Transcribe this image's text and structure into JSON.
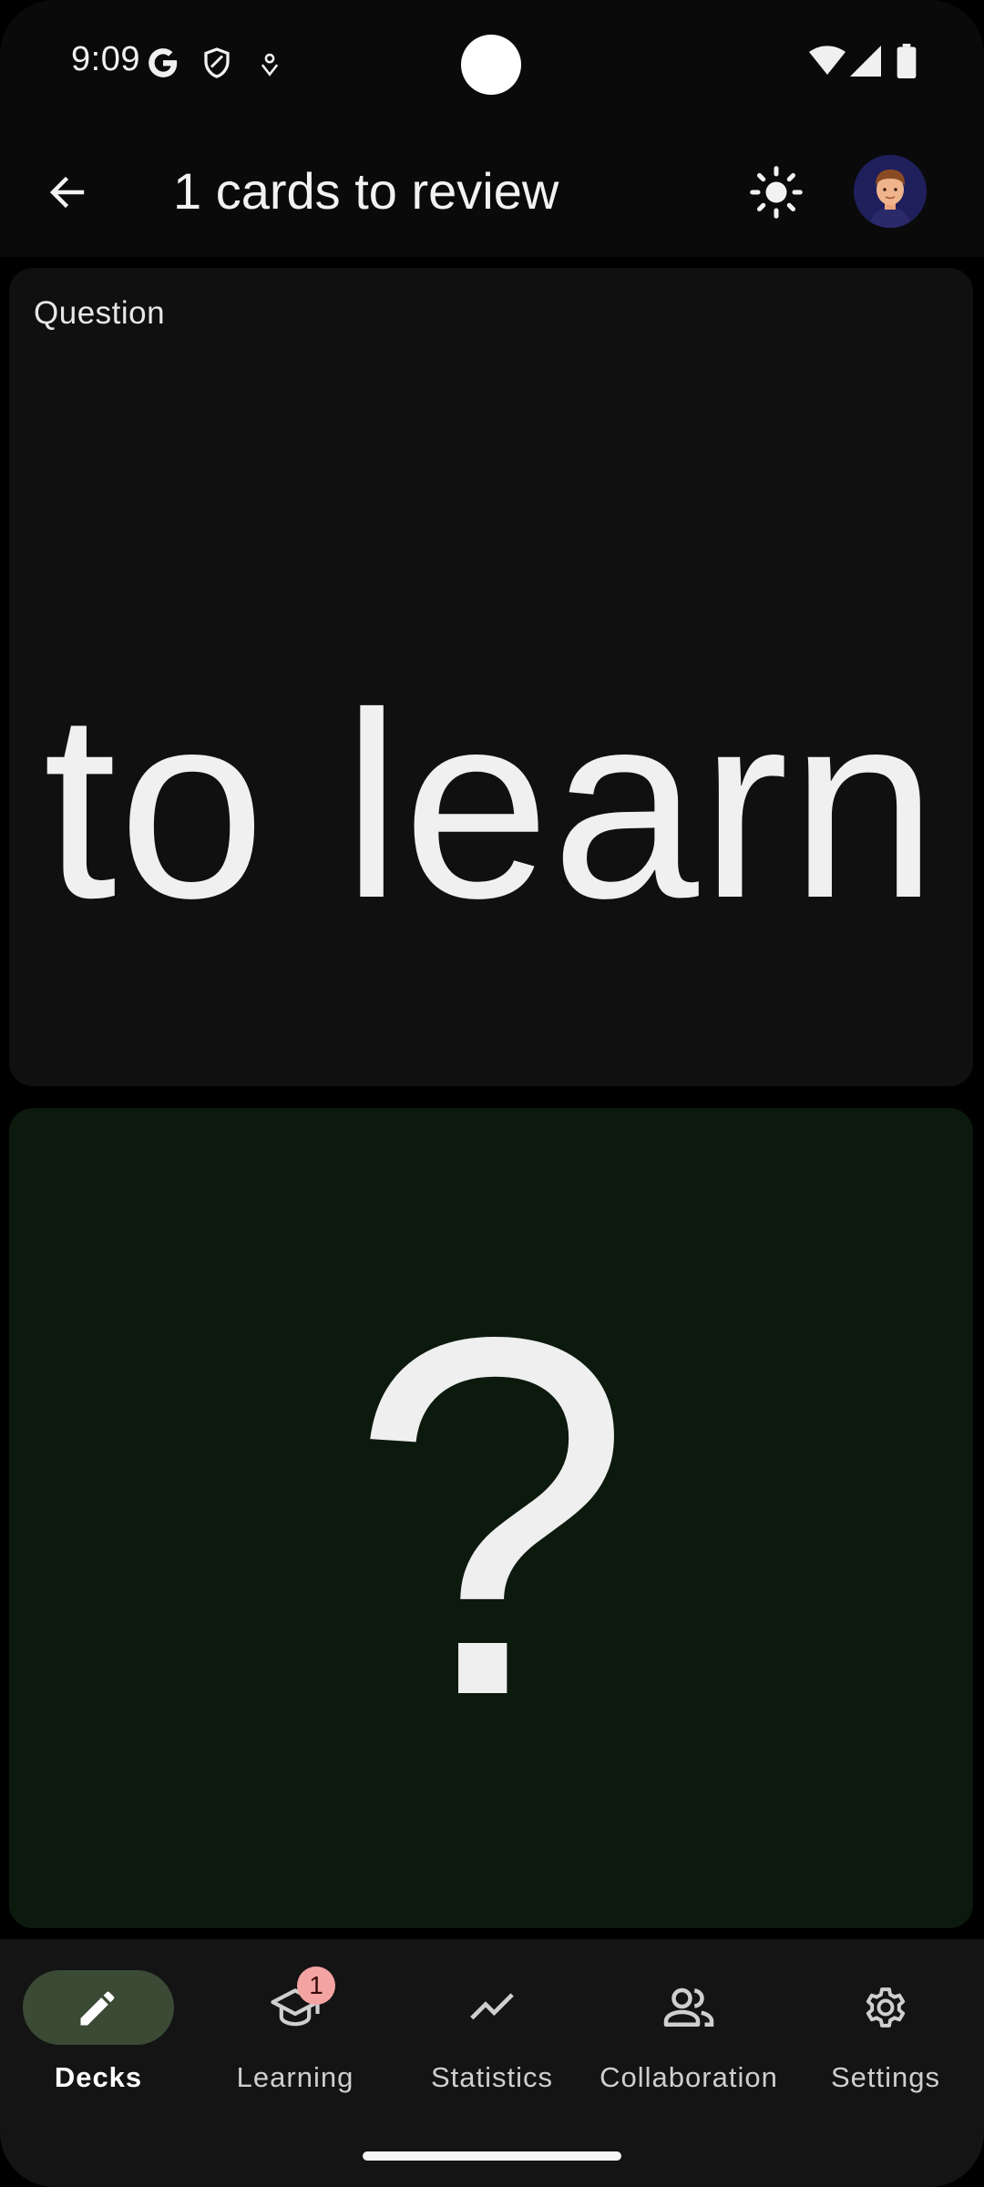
{
  "status_bar": {
    "time": "9:09",
    "left_icons": [
      "google-g-icon",
      "shield-icon",
      "location-pin-icon"
    ],
    "right_icons": [
      "wifi-icon",
      "cellular-signal-icon",
      "battery-icon"
    ]
  },
  "app_bar": {
    "title": "1 cards to review",
    "back_icon": "arrow-left-icon",
    "theme_icon": "sun-icon",
    "avatar_icon": "user-avatar"
  },
  "question_card": {
    "label": "Question",
    "text": "to learn"
  },
  "answer_card": {
    "mark": "?",
    "background": "#0c1a0d"
  },
  "bottom_nav": {
    "items": [
      {
        "label": "Decks",
        "icon": "pencil-icon",
        "active": true
      },
      {
        "label": "Learning",
        "icon": "graduation-cap-icon",
        "badge": "1"
      },
      {
        "label": "Statistics",
        "icon": "trend-line-icon"
      },
      {
        "label": "Collaboration",
        "icon": "people-icon"
      },
      {
        "label": "Settings",
        "icon": "gear-icon"
      }
    ]
  },
  "colors": {
    "background": "#000000",
    "surface": "#101010",
    "nav_surface": "#141414",
    "active_pill": "#3a4a35",
    "badge": "#f4a3a3",
    "text": "#f2f2f2"
  }
}
